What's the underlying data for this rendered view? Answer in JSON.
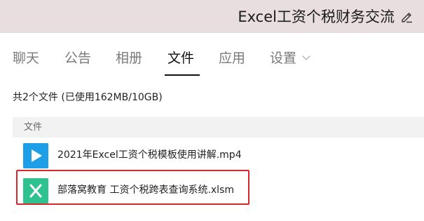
{
  "header": {
    "group_title": "Excel工资个税财务交流",
    "edit_icon": "pencil-icon",
    "background_color": "#e8dedf"
  },
  "tabs": [
    {
      "label": "聊天",
      "active": false
    },
    {
      "label": "公告",
      "active": false
    },
    {
      "label": "相册",
      "active": false
    },
    {
      "label": "文件",
      "active": true
    },
    {
      "label": "应用",
      "active": false
    },
    {
      "label": "设置",
      "active": false,
      "has_dropdown": true
    }
  ],
  "files": {
    "summary": "共2个文件 (已使用162MB/10GB)",
    "column_header": "文件",
    "items": [
      {
        "name": "2021年Excel工资个税模板使用讲解.mp4",
        "icon": "video-play-icon",
        "icon_color": "#1c9fe6",
        "highlighted": false
      },
      {
        "name": "部落窝教育  工资个税跨表查询系统.xlsm",
        "icon": "excel-file-icon",
        "icon_color": "#2dc28f",
        "highlighted": true
      }
    ]
  },
  "colors": {
    "highlight_border": "#d9262c",
    "active_tab": "#111111",
    "inactive_tab": "#7a7a7a"
  }
}
